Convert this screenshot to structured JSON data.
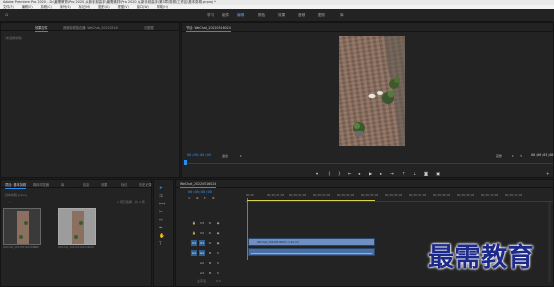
{
  "app": {
    "title": "Adobe Premiere Pro 2020 - D:\\最需教育\\Pro 2020 从新手到高手\\最需素材\\Pro 2020 从新手到高手\\第3章\\剪辑\\工作区\\基本剪辑.prproj *",
    "menu": [
      "文件(F)",
      "编辑(E)",
      "剪辑(C)",
      "序列(S)",
      "标记(M)",
      "图形(G)",
      "视图(V)",
      "窗口(W)",
      "帮助(H)"
    ]
  },
  "workspace": {
    "tabs": [
      "学习",
      "组件",
      "编辑",
      "颜色",
      "效果",
      "音频",
      "图形",
      "库"
    ],
    "active_tab": "编辑"
  },
  "source_panel": {
    "tabs": [
      "效果控件",
      "音频剪辑混合器: WeChat_20220516"
    ],
    "extra_tab": "元数据",
    "empty_text": "(未选择剪辑)"
  },
  "program_monitor": {
    "title": "节目: WeChat_20220516024",
    "timecode": "00;00;00;00",
    "fit_label": "适合",
    "quality": "完整",
    "duration": "00;00;03;08"
  },
  "project_panel": {
    "tabs": [
      "项目: 基本剪辑",
      "媒体浏览器",
      "库",
      "信息",
      "效果",
      "标记",
      "历史记录"
    ],
    "path": "基本剪辑.prproj",
    "item_count": "1 项已选择，共 2 项",
    "items": [
      {
        "name": "WeChat_2022051602424...",
        "duration": "3;08"
      },
      {
        "name": "WeChat_202205160242...",
        "duration": "3;08"
      }
    ]
  },
  "timeline": {
    "sequence_tab": "WeChat_20220516024",
    "timecode": "00;00;00;00",
    "ruler": [
      "00;00",
      "00;00;01;00",
      "00;00;02;00",
      "00;00;03;00",
      "00;00;04;00",
      "00;00;05;00",
      "00;00;06;00",
      "00;00;07;00",
      "00;00;08;00",
      "00;00;09;00",
      "00;00;10;00",
      "00;00;11;00"
    ],
    "video_tracks": [
      "V3",
      "V2",
      "V1"
    ],
    "audio_tracks": [
      "A1",
      "A2",
      "A3"
    ],
    "source_patch": [
      "V1",
      "A1"
    ],
    "clip_video_label": "WeChat_20220516024..mp4 [V]",
    "master_label": "主声道",
    "master_value": "0.0"
  },
  "watermark": "最需教育",
  "colors": {
    "accent": "#2d8ceb",
    "clip_video": "#6e8fc2",
    "clip_audio": "#4a6fa5",
    "watermark": "#1e2a8a"
  }
}
